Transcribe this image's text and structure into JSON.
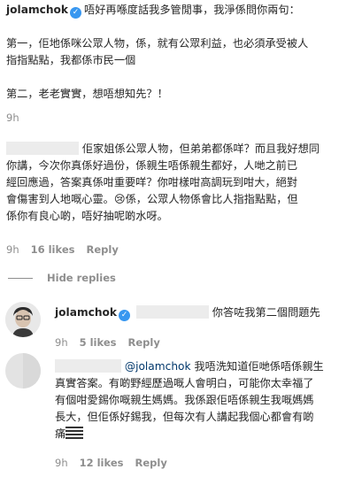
{
  "post": {
    "username": "jolamchok",
    "lines": [
      "唔好再喺度話我多管閒事，我淨係問你兩句：",
      "第一，佢地係咪公眾人物，係，就有公眾利益，也必須承受被人",
      "指指點點，我都係市民一個",
      "第二，老老實實，想唔想知先？！"
    ],
    "time": "9h"
  },
  "comment1": {
    "lines": [
      "佢家姐係公眾人物，但弟弟都係咩？而且我好想同",
      "你講，今次你真係好過份，係親生唔係親生都好，人哋之前已",
      "經回應過，答案真係咁重要咩？你咁樣咁高調玩到咁大，絕對",
      "會傷害到人地嘅心靈。😢係，公眾人物係會比人指指點點，但",
      "係你有良心啲，唔好抽呢啲水呀。"
    ],
    "time": "9h",
    "likes": "16 likes",
    "reply": "Reply"
  },
  "hide_replies": "Hide replies",
  "reply1": {
    "username": "jolamchok",
    "text": "你答咗我第二個問題先",
    "time": "9h",
    "likes": "5 likes",
    "reply": "Reply"
  },
  "reply2": {
    "mention": "@jolamchok",
    "lines": [
      "我唔洗知道佢哋係唔係親生",
      "真實答案。有啲野經歷過嘅人會明白，可能你太幸福了",
      "有個咁愛錫你嘅親生媽媽。我係跟佢唔係親生我嘅媽媽",
      "長大，但佢係好錫我，但每次有人講起我個心都會有啲",
      "痛"
    ],
    "time": "9h",
    "likes": "12 likes",
    "reply": "Reply"
  },
  "icons": {
    "verified": "verified-badge-icon",
    "avatar": "avatar",
    "hidden": "blurred-username"
  },
  "colors": {
    "text": "#262626",
    "meta": "#8e8e8e",
    "verified": "#3897f0",
    "link": "#00376b"
  }
}
